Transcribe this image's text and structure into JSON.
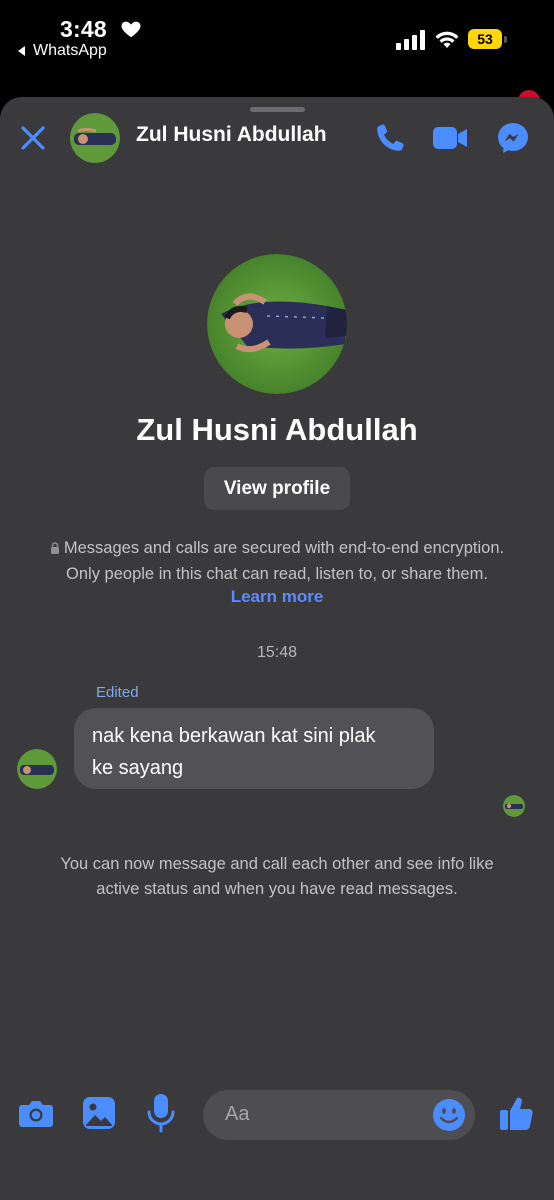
{
  "status_bar": {
    "time": "3:48",
    "back_app": "WhatsApp",
    "battery": "53"
  },
  "header": {
    "contact_name": "Zul Husni Abdullah"
  },
  "profile": {
    "name": "Zul Husni Abdullah",
    "view_profile_label": "View profile"
  },
  "encryption": {
    "line1": "Messages and calls are secured with end-to-end encryption.",
    "line2": "Only people in this chat can read, listen to, or share them.",
    "learn_more": "Learn more"
  },
  "conversation": {
    "timestamp": "15:48",
    "edited_label": "Edited",
    "message_line1": "nak kena berkawan kat sini plak",
    "message_line2": "ke sayang",
    "system_line1": "You can now message and call each other and see info like",
    "system_line2": "active status and when you have read messages."
  },
  "composer": {
    "placeholder": "Aa"
  },
  "colors": {
    "accent": "#4b8cff",
    "sheet_bg": "#3a3a3c",
    "bubble_bg": "#525256",
    "battery": "#ffd60a"
  },
  "icons": [
    "heart-icon",
    "back-arrow-icon",
    "signal-icon",
    "wifi-icon",
    "battery-icon",
    "close-icon",
    "phone-icon",
    "video-icon",
    "messenger-icon",
    "lock-icon",
    "camera-icon",
    "gallery-icon",
    "mic-icon",
    "emoji-icon",
    "thumbs-up-icon"
  ]
}
